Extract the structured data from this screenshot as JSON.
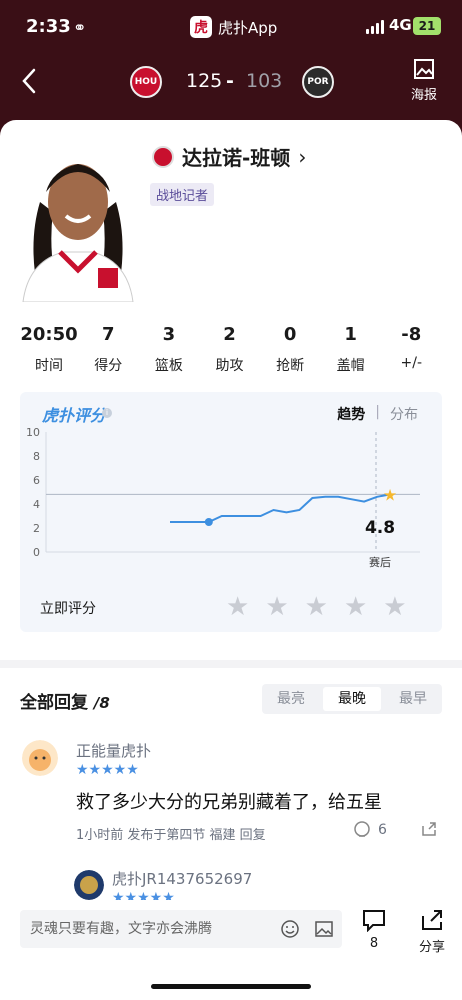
{
  "status_bar": {
    "time": "2:33",
    "app_badge": "虎扑App",
    "app_logo_char": "虎",
    "network": "4G",
    "battery": "21"
  },
  "header": {
    "home_team_abbr": "HOU",
    "home_score": "125",
    "separator": "-",
    "away_score": "103",
    "away_team_abbr": "POR",
    "poster_label": "海报",
    "accent": "#3a0f16"
  },
  "player": {
    "name": "达拉诺-班顿",
    "tag": "战地记者",
    "stats": [
      {
        "value": "20:50",
        "label": "时间"
      },
      {
        "value": "7",
        "label": "得分"
      },
      {
        "value": "3",
        "label": "篮板"
      },
      {
        "value": "2",
        "label": "助攻"
      },
      {
        "value": "0",
        "label": "抢断"
      },
      {
        "value": "1",
        "label": "盖帽"
      },
      {
        "value": "-8",
        "label": "+/-"
      }
    ]
  },
  "rating": {
    "logo": "虎扑评分",
    "tab_trend": "趋势",
    "tab_sep": "|",
    "tab_dist": "分布",
    "final_score": "4.8",
    "final_label": "赛后",
    "rate_now": "立即评分",
    "star_count": 5
  },
  "chart_data": {
    "type": "line",
    "ylim": [
      0,
      10
    ],
    "yticks": [
      "10",
      "8",
      "6",
      "4",
      "2",
      "0"
    ],
    "average_line": 4.8,
    "series": [
      {
        "values": [
          2.5,
          2.5,
          2.5,
          2.5,
          3.0,
          3.0,
          3.0,
          3.0,
          3.5,
          3.3,
          3.5,
          4.5,
          4.6,
          4.6,
          4.4,
          4.2,
          4.6,
          4.8
        ]
      }
    ],
    "highlight_index": 3,
    "line_color": "#3d8fe0",
    "star_color": "#f5b82e"
  },
  "replies": {
    "title": "全部回复",
    "count": "/8",
    "sort": [
      "最亮",
      "最晚",
      "最早"
    ],
    "sort_active": 1,
    "items": [
      {
        "user": "正能量虎扑",
        "stars": "★★★★★",
        "text": "救了多少大分的兄弟别藏着了，给五星",
        "meta": "1小时前 发布于第四节 福建 回复",
        "likes": "6"
      },
      {
        "user": "虎扑JR1437652697",
        "stars": "★★★★★"
      }
    ]
  },
  "bottom": {
    "placeholder": "灵魂只要有趣，文字亦会沸腾",
    "comment_count": "8",
    "share_label": "分享"
  }
}
